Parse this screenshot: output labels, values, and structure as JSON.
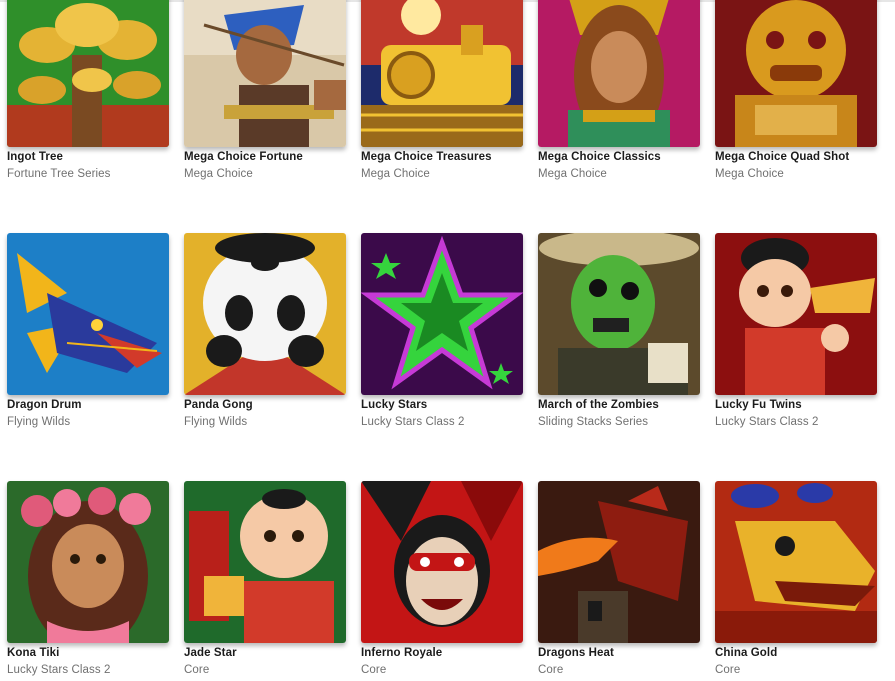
{
  "games": [
    {
      "title": "Ingot Tree",
      "series": "Fortune Tree Series",
      "icon": "golden-ingot-tree-icon",
      "colors": [
        "#2f8f2a",
        "#e4b334"
      ]
    },
    {
      "title": "Mega Choice Fortune",
      "series": "Mega Choice",
      "icon": "pharaoh-archer-icon",
      "colors": [
        "#5a3a28",
        "#2d5fbf"
      ]
    },
    {
      "title": "Mega Choice Treasures",
      "series": "Mega Choice",
      "icon": "golden-train-icon",
      "colors": [
        "#c0392b",
        "#f1c232"
      ]
    },
    {
      "title": "Mega Choice Classics",
      "series": "Mega Choice",
      "icon": "goddess-portrait-icon",
      "colors": [
        "#b51a63",
        "#d4a017"
      ]
    },
    {
      "title": "Mega Choice Quad Shot",
      "series": "Mega Choice",
      "icon": "golden-foo-dog-icon",
      "colors": [
        "#7a1414",
        "#d99a1e"
      ]
    },
    {
      "title": "Dragon Drum",
      "series": "Flying Wilds",
      "icon": "blue-dragon-icon",
      "colors": [
        "#1d7fc7",
        "#2a3a9c"
      ]
    },
    {
      "title": "Panda Gong",
      "series": "Flying Wilds",
      "icon": "panda-icon",
      "colors": [
        "#e3b12a",
        "#f5f5f5"
      ]
    },
    {
      "title": "Lucky Stars",
      "series": "Lucky Stars Class 2",
      "icon": "green-star-icon",
      "colors": [
        "#3b0a4a",
        "#35d43d"
      ]
    },
    {
      "title": "March of the Zombies",
      "series": "Sliding Stacks Series",
      "icon": "zombie-icon",
      "colors": [
        "#5c4a2c",
        "#4fb33a"
      ]
    },
    {
      "title": "Lucky Fu Twins",
      "series": "Lucky Stars Class 2",
      "icon": "fu-child-icon",
      "colors": [
        "#8c0f0f",
        "#f0b43a"
      ]
    },
    {
      "title": "Kona Tiki",
      "series": "Lucky Stars Class 2",
      "icon": "hula-girl-icon",
      "colors": [
        "#2b6a2a",
        "#e05a7a"
      ]
    },
    {
      "title": "Jade Star",
      "series": "Core",
      "icon": "jade-child-icon",
      "colors": [
        "#1f6a2b",
        "#d23a2a"
      ]
    },
    {
      "title": "Inferno Royale",
      "series": "Core",
      "icon": "jester-devil-icon",
      "colors": [
        "#c31515",
        "#1a1a1a"
      ]
    },
    {
      "title": "Dragons Heat",
      "series": "Core",
      "icon": "red-dragon-icon",
      "colors": [
        "#8e1c10",
        "#f07a1a"
      ]
    },
    {
      "title": "China Gold",
      "series": "Core",
      "icon": "chinese-dragon-icon",
      "colors": [
        "#b22a12",
        "#e9b22a"
      ]
    }
  ]
}
